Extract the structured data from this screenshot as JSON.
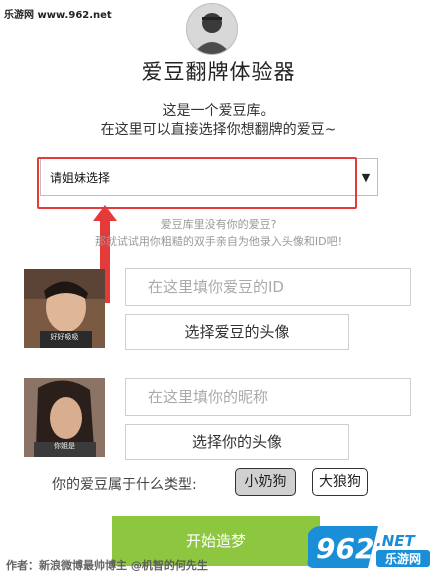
{
  "watermark_top": "乐游网 www.962.net",
  "app_title": "爱豆翻牌体验器",
  "intro": {
    "line1": "这是一个爱豆库。",
    "line2": "在这里可以直接选择你想翻牌的爱豆~"
  },
  "select": {
    "value": "请姐妹选择"
  },
  "hint": {
    "line1": "爱豆库里没有你的爱豆?",
    "line2": "那就试试用你粗糙的双手亲自为他录入头像和ID吧!"
  },
  "idol": {
    "photo_caption": "好好吸吸",
    "id_placeholder": "在这里填你爱豆的ID",
    "choose_avatar_label": "选择爱豆的头像"
  },
  "user": {
    "photo_caption": "你姐是",
    "nickname_placeholder": "在这里填你的昵称",
    "choose_avatar_label": "选择你的头像"
  },
  "type": {
    "label": "你的爱豆属于什么类型:",
    "options": [
      "小奶狗",
      "大狼狗"
    ],
    "selected": "小奶狗"
  },
  "start_button": "开始造梦",
  "author": "作者：新浪微博最帅博主 @机智的何先生",
  "watermark_br": {
    "number": "962",
    "suffix": ".NET",
    "cn": "乐游网"
  },
  "colors": {
    "accent_green": "#8dc63f",
    "highlight_red": "#e43a3a"
  }
}
